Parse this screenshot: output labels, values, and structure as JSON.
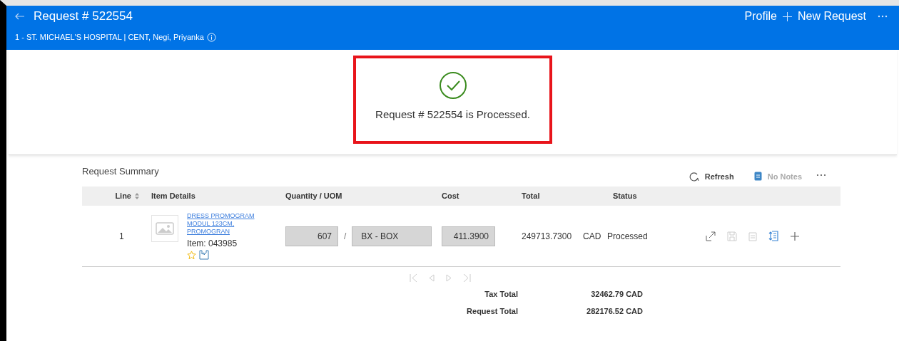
{
  "header": {
    "title": "Request # 522554",
    "context": "1 - ST. MICHAEL'S HOSPITAL | CENT, Negi, Priyanka",
    "links": [
      {
        "kind": "text",
        "label": "Profile"
      },
      {
        "kind": "add",
        "label": "New Request"
      }
    ]
  },
  "banner": {
    "message": "Request # 522554 is Processed.",
    "highlighted": true
  },
  "summary": {
    "title": "Request Summary",
    "toolbar": [
      {
        "kind": "refresh",
        "label": "Refresh",
        "disabled": false
      },
      {
        "kind": "notes",
        "label": "No Notes",
        "disabled": true
      }
    ],
    "columns": [
      "Line",
      "Item Details",
      "Quantity / UOM",
      "Cost",
      "Total",
      "Status"
    ],
    "rows": [
      {
        "line": "1",
        "description": "DRESS PROMOGRAM MODUL 123CM, PROMOGRAN",
        "item": "Item: 043985",
        "favorite": false,
        "quantity": "607",
        "separator": "/",
        "uom": "BX - BOX",
        "cost": "411.3900",
        "total": "249713.7300",
        "currency": "CAD",
        "status": "Processed",
        "actions": [
          {
            "kind": "open",
            "disabled": false
          },
          {
            "kind": "save",
            "disabled": true
          },
          {
            "kind": "note",
            "disabled": true
          },
          {
            "kind": "split",
            "disabled": false
          },
          {
            "kind": "add",
            "disabled": false
          }
        ]
      }
    ],
    "totals": [
      {
        "label": "Tax Total",
        "value": "32462.79 CAD"
      },
      {
        "label": "Request Total",
        "value": "282176.52 CAD"
      }
    ]
  }
}
